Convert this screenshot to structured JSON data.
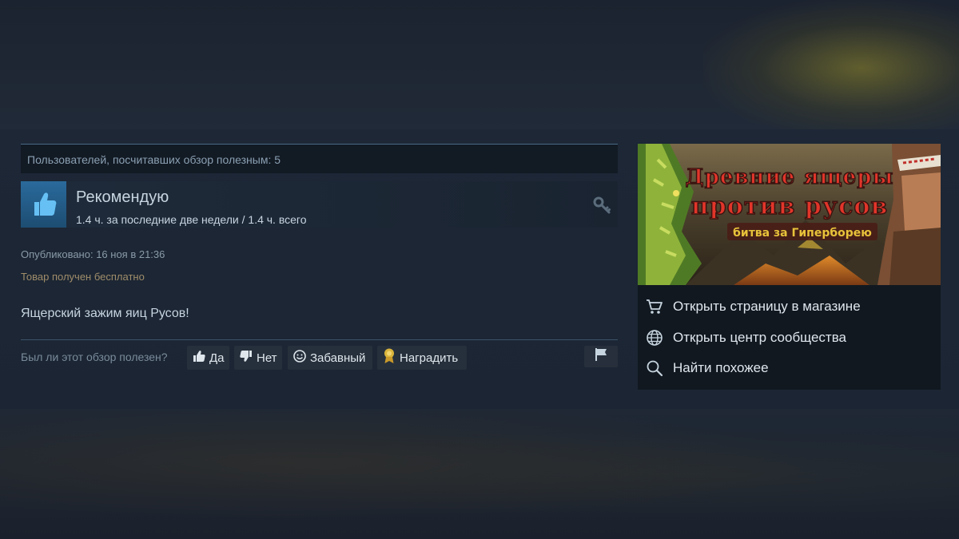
{
  "review": {
    "helpful_count_text": "Пользователей, посчитавших обзор полезным: 5",
    "recommendation": "Рекомендую",
    "hours_text": "1.4 ч. за последние две недели / 1.4 ч. всего",
    "posted_text": "Опубликовано: 16 ноя в 21:36",
    "received_text": "Товар получен бесплатно",
    "body_text": "Ящерский зажим яиц Русов!"
  },
  "voting": {
    "question": "Был ли этот обзор полезен?",
    "yes_label": "Да",
    "no_label": "Нет",
    "funny_label": "Забавный",
    "award_label": "Наградить"
  },
  "sidebar": {
    "capsule": {
      "title_line1": "Древние ящеры",
      "title_line2": "против русов",
      "subtitle": "битва за Гиперборею"
    },
    "links": [
      {
        "label": "Открыть страницу в магазине",
        "icon": "cart-icon"
      },
      {
        "label": "Открыть центр сообщества",
        "icon": "globe-icon"
      },
      {
        "label": "Найти похожее",
        "icon": "magnifier-icon"
      }
    ]
  },
  "colors": {
    "accent_blue": "#2a6a9c",
    "award_gold": "#d9b43c",
    "capsule_title_red": "#e2352a",
    "capsule_subtitle_yellow": "#e8c23a"
  }
}
